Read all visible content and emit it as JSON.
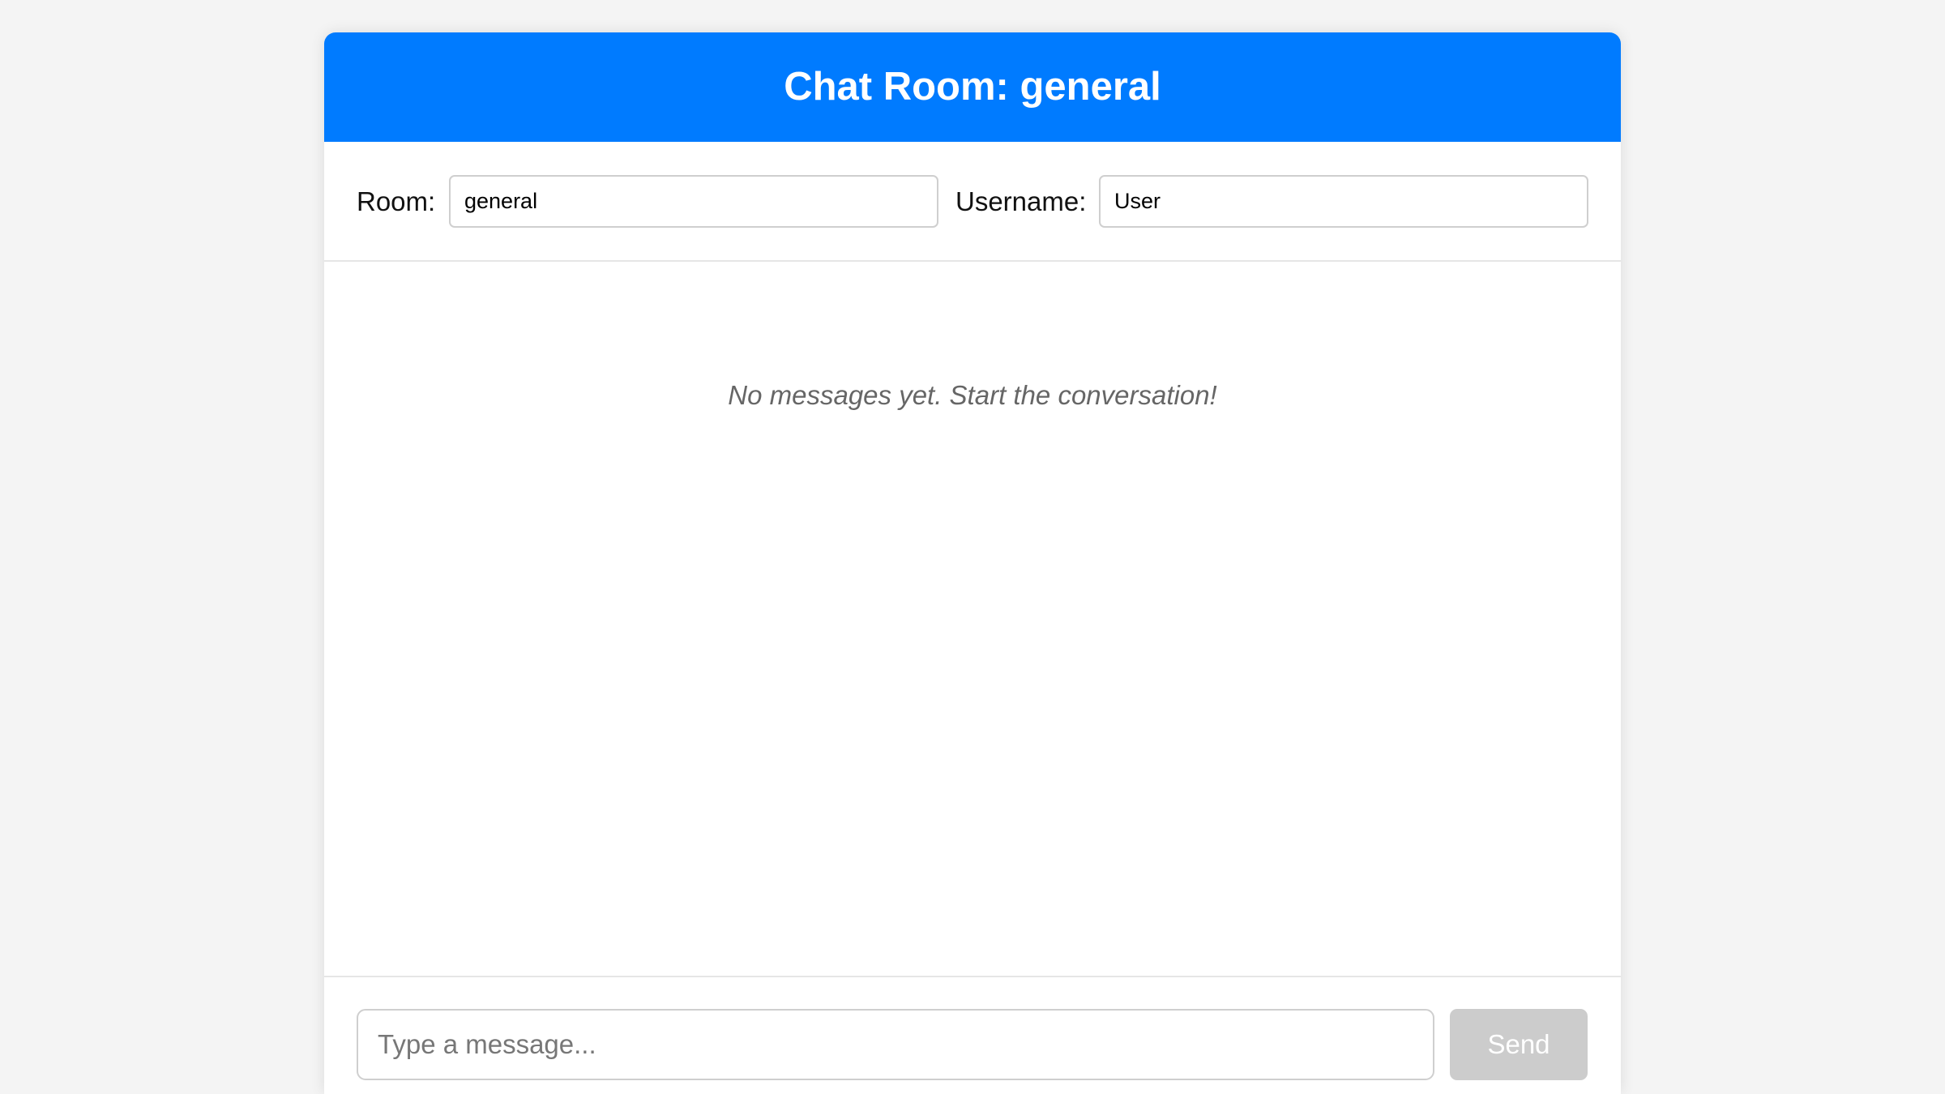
{
  "header": {
    "title": "Chat Room: general"
  },
  "settings": {
    "room_label": "Room:",
    "room_value": "general",
    "username_label": "Username:",
    "username_value": "User"
  },
  "messages": {
    "empty_text": "No messages yet. Start the conversation!"
  },
  "composer": {
    "placeholder": "Type a message...",
    "value": "",
    "send_label": "Send",
    "send_disabled": true
  },
  "colors": {
    "header_background": "#007bff",
    "page_background": "#f4f4f4",
    "send_button_disabled": "#cccccc"
  }
}
